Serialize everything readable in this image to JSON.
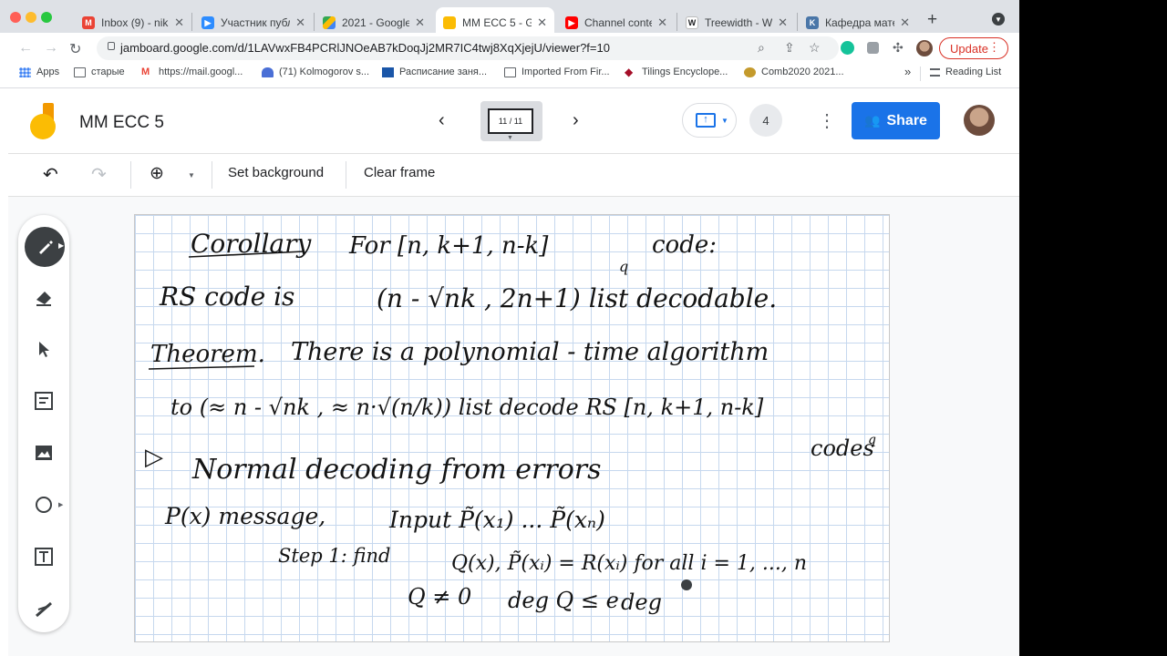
{
  "browser": {
    "tabs": [
      {
        "title": "Inbox (9) - nik",
        "favicon_color": "#ea4335",
        "active": false
      },
      {
        "title": "Участник публ",
        "favicon_color": "#2d8cff",
        "active": false
      },
      {
        "title": "2021 - Google",
        "favicon_color": "#34a853",
        "active": false
      },
      {
        "title": "MM ECC 5 - G",
        "favicon_color": "#fbbc04",
        "active": true
      },
      {
        "title": "Channel conte",
        "favicon_color": "#ff0000",
        "active": false
      },
      {
        "title": "Treewidth - Wi",
        "favicon_color": "#5f6368",
        "active": false
      },
      {
        "title": "Кафедра мате",
        "favicon_color": "#4a76a8",
        "active": false
      }
    ],
    "url": "jamboard.google.com/d/1LAVwxFB4PCRlJNOeAB7kDoqJj2MR7IC4twj8XqXjejU/viewer?f=10",
    "update_label": "Update",
    "bookmarks": [
      {
        "label": "Apps",
        "icon": "apps-grid-icon"
      },
      {
        "label": "старые",
        "icon": "folder-icon"
      },
      {
        "label": "https://mail.googl...",
        "icon": "gmail-icon"
      },
      {
        "label": "(71) Kolmogorov s...",
        "icon": "people-icon"
      },
      {
        "label": "Расписание заня...",
        "icon": "blue-square-icon"
      },
      {
        "label": "Imported From Fir...",
        "icon": "folder-icon"
      },
      {
        "label": "Tilings Encyclope...",
        "icon": "diamond-icon"
      },
      {
        "label": "Comb2020 2021...",
        "icon": "medal-icon"
      }
    ],
    "reading_list": "Reading List",
    "more_bookmarks": "»"
  },
  "app": {
    "title": "MM ECC 5",
    "frame_indicator": "11 / 11",
    "collaborators": "4",
    "share_label": "Share",
    "accent": "#1a73e8"
  },
  "editbar": {
    "set_background": "Set background",
    "clear_frame": "Clear frame"
  },
  "tools": [
    "pen-icon",
    "eraser-icon",
    "select-icon",
    "sticky-note-icon",
    "image-icon",
    "circle-icon",
    "textbox-icon",
    "laser-icon"
  ],
  "board": {
    "lines": [
      "Corollary",
      "For [n, k+1, n-k]",
      "q",
      "code:",
      "RS code is",
      "(n - √nk , 2n+1) list decodable.",
      "Theorem.",
      "There is a polynomial - time algorithm",
      "to (≈ n - √nk , ≈ n·√(n/k)) list decode RS [n, k+1, n-k]",
      "q",
      "codes",
      "▷",
      "Normal decoding from errors",
      "P(x) message,",
      "Input P̃(x₁) ... P̃(xₙ)",
      "Step 1: find",
      "Q(x), P̃(xᵢ) = R(xᵢ) for all i = 1, ..., n",
      "Q ≠ 0",
      "deg Q ≤ e",
      "deg"
    ]
  }
}
